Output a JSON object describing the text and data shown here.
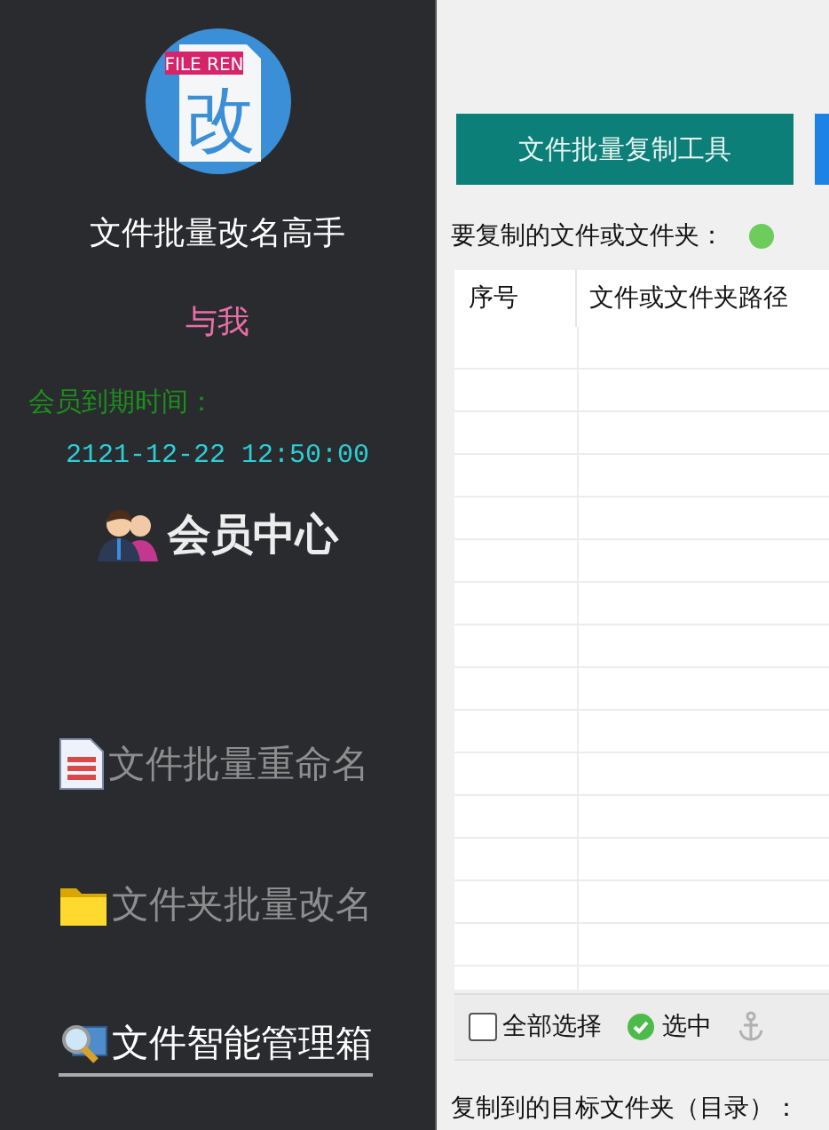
{
  "sidebar": {
    "logo": {
      "badge": "FILE REN",
      "glyph": "改"
    },
    "app_title": "文件批量改名高手",
    "about_link": "与我",
    "membership": {
      "label": "会员到期时间：",
      "expiry": "2121-12-22 12:50:00"
    },
    "member_center": "会员中心",
    "nav_items": [
      {
        "kind": "document",
        "label": "文件批量重命名",
        "selected": false
      },
      {
        "kind": "folder",
        "label": "文件夹批量改名",
        "selected": false
      },
      {
        "kind": "magnifier",
        "label": "文件智能管理箱",
        "selected": true
      }
    ]
  },
  "main": {
    "tool_button": "文件批量复制工具",
    "source_label": "要复制的文件或文件夹：",
    "table": {
      "columns": [
        "序号",
        "文件或文件夹路径"
      ]
    },
    "select_all": {
      "label": "全部选择",
      "checked": false
    },
    "select_button": "选中",
    "target_label": "复制到的目标文件夹（目录）："
  }
}
